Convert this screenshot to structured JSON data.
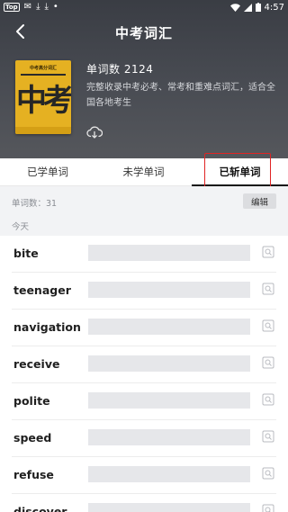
{
  "status_bar": {
    "app_label": "Top",
    "time": "4:57"
  },
  "header": {
    "title": "中考词汇",
    "word_count": "单词数 2124",
    "description": "完整收录中考必考、常考和重难点词汇，适合全国各地考生"
  },
  "book_cover": {
    "small_title": "中考高分词汇",
    "big_text": "中考",
    "accent_color": "#e5b122"
  },
  "tabs": [
    {
      "label": "已学单词",
      "active": false
    },
    {
      "label": "未学单词",
      "active": false
    },
    {
      "label": "已斩单词",
      "active": true
    }
  ],
  "list_header": {
    "word_total": "单词数：31",
    "edit_label": "编辑",
    "day_label": "今天"
  },
  "words": [
    {
      "word": "bite"
    },
    {
      "word": "teenager"
    },
    {
      "word": "navigation"
    },
    {
      "word": "receive"
    },
    {
      "word": "polite"
    },
    {
      "word": "speed"
    },
    {
      "word": "refuse"
    },
    {
      "word": "discover"
    }
  ],
  "colors": {
    "highlight_box": "#e02424",
    "header_bg": "#494c53"
  }
}
